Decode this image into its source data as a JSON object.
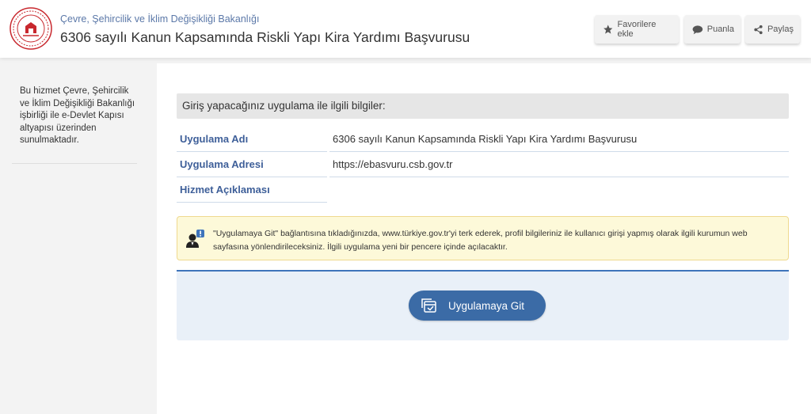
{
  "header": {
    "ministry": "Çevre, Şehircilik ve İklim Değişikliği Bakanlığı",
    "title": "6306 sayılı Kanun Kapsamında Riskli Yapı Kira Yardımı Başvurusu",
    "buttons": {
      "favorite": "Favorilere ekle",
      "rate": "Puanla",
      "share": "Paylaş"
    }
  },
  "sidebar": {
    "description": "Bu hizmet Çevre, Şehircilik ve İklim Değişikliği Bakanlığı işbirliği ile e-Devlet Kapısı altyapısı üzerinden sunulmaktadır."
  },
  "info": {
    "heading": "Giriş yapacağınız uygulama ile ilgili bilgiler:",
    "rows": [
      {
        "label": "Uygulama Adı",
        "value": "6306 sayılı Kanun Kapsamında Riskli Yapı Kira Yardımı Başvurusu"
      },
      {
        "label": "Uygulama Adresi",
        "value": "https://ebasvuru.csb.gov.tr"
      },
      {
        "label": "Hizmet Açıklaması",
        "value": ""
      }
    ]
  },
  "notice": {
    "text": "\"Uygulamaya Git\" bağlantısına tıkladığınızda, www.türkiye.gov.tr'yi terk ederek, profil bilgileriniz ile kullanıcı girişi yapmış olarak ilgili kurumun web sayfasına yönlendirileceksiniz. İlgili uygulama yeni bir pencere içinde açılacaktır."
  },
  "action": {
    "go_label": "Uygulamaya Git"
  },
  "icons": {
    "logo": "ministry-emblem",
    "favorite": "star-icon",
    "rate": "speech-bubble-icon",
    "share": "share-icon",
    "notice": "user-alert-icon",
    "go": "window-open-icon"
  },
  "colors": {
    "accent": "#3b6ba6",
    "label": "#3e5f99",
    "logo_red": "#c8282e",
    "notice_bg": "#fdf9d9"
  }
}
